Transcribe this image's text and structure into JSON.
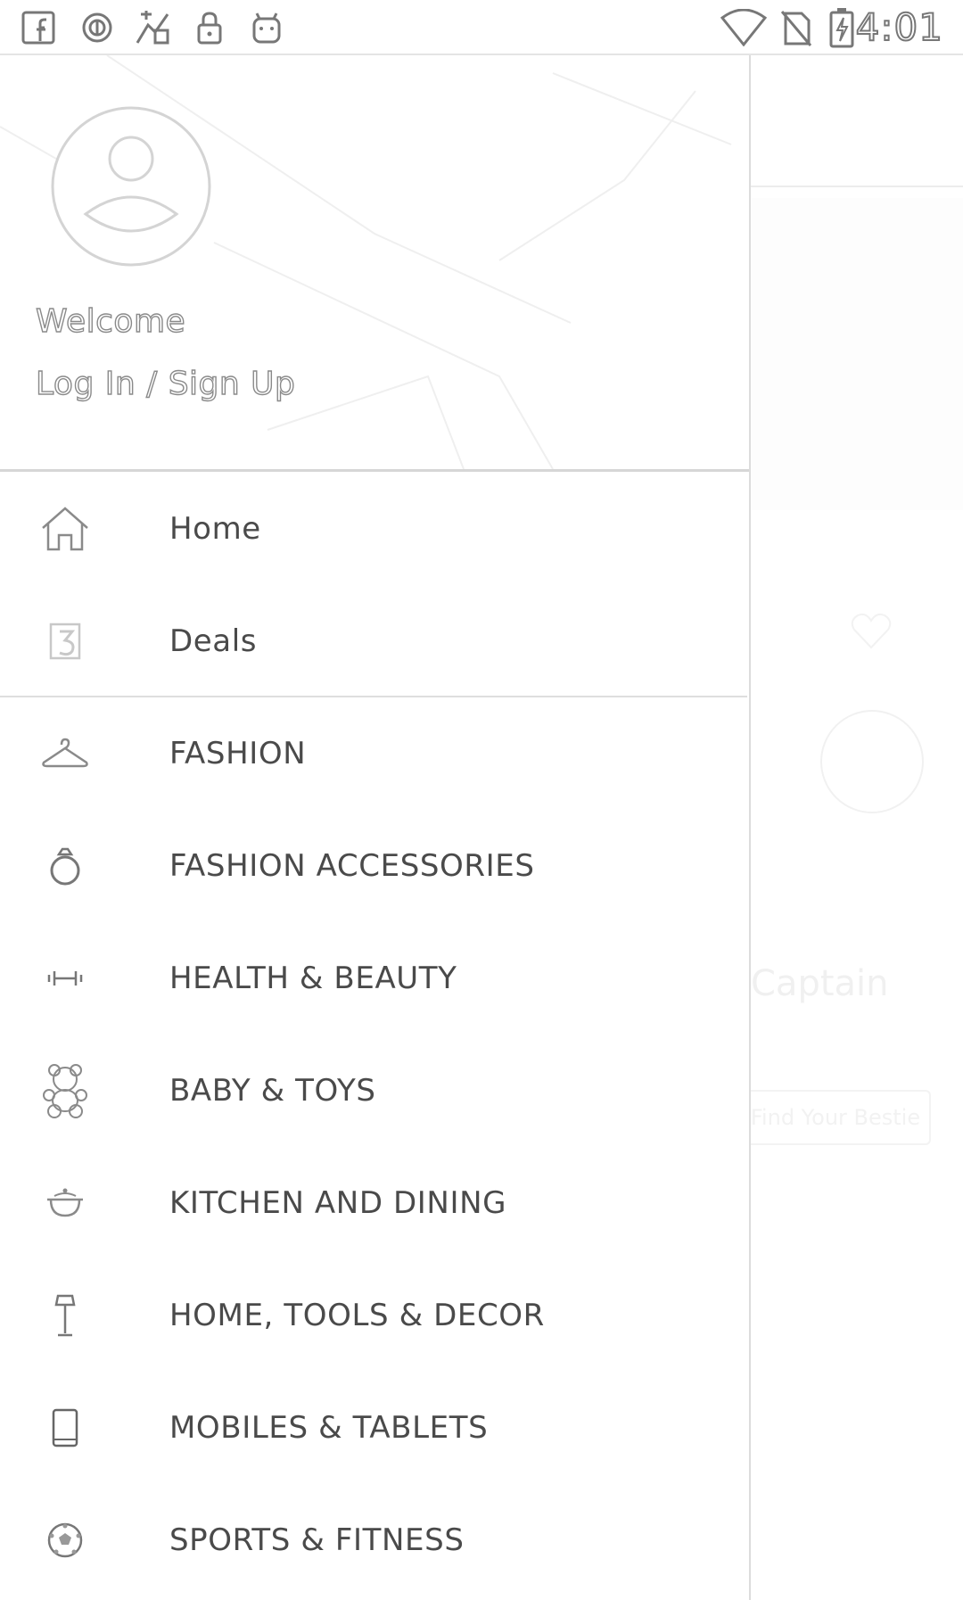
{
  "status_bar": {
    "time": "4:01",
    "icons": [
      "facebook-icon",
      "circle-notification-icon",
      "app-notification-icon",
      "lock-icon",
      "android-icon",
      "wifi-icon",
      "no-sim-icon",
      "battery-charging-icon"
    ]
  },
  "drawer": {
    "header": {
      "welcome": "Welcome",
      "login": "Log In / Sign Up"
    },
    "primary_items": [
      {
        "label": "Home",
        "icon": "home-icon"
      },
      {
        "label": "Deals",
        "icon": "deals-icon"
      }
    ],
    "category_items": [
      {
        "label": "FASHION",
        "icon": "hanger-icon"
      },
      {
        "label": "FASHION ACCESSORIES",
        "icon": "ring-icon"
      },
      {
        "label": "HEALTH & BEAUTY",
        "icon": "dumbbell-icon"
      },
      {
        "label": "BABY & TOYS",
        "icon": "teddy-bear-icon"
      },
      {
        "label": "KITCHEN AND DINING",
        "icon": "cooking-pot-icon"
      },
      {
        "label": "HOME, TOOLS & DECOR",
        "icon": "lamp-icon"
      },
      {
        "label": "MOBILES & TABLETS",
        "icon": "mobile-icon"
      },
      {
        "label": "SPORTS & FITNESS",
        "icon": "football-icon"
      }
    ]
  },
  "background_app": {
    "partial_text": "Captain",
    "partial_button": "Find Your Bestie"
  }
}
